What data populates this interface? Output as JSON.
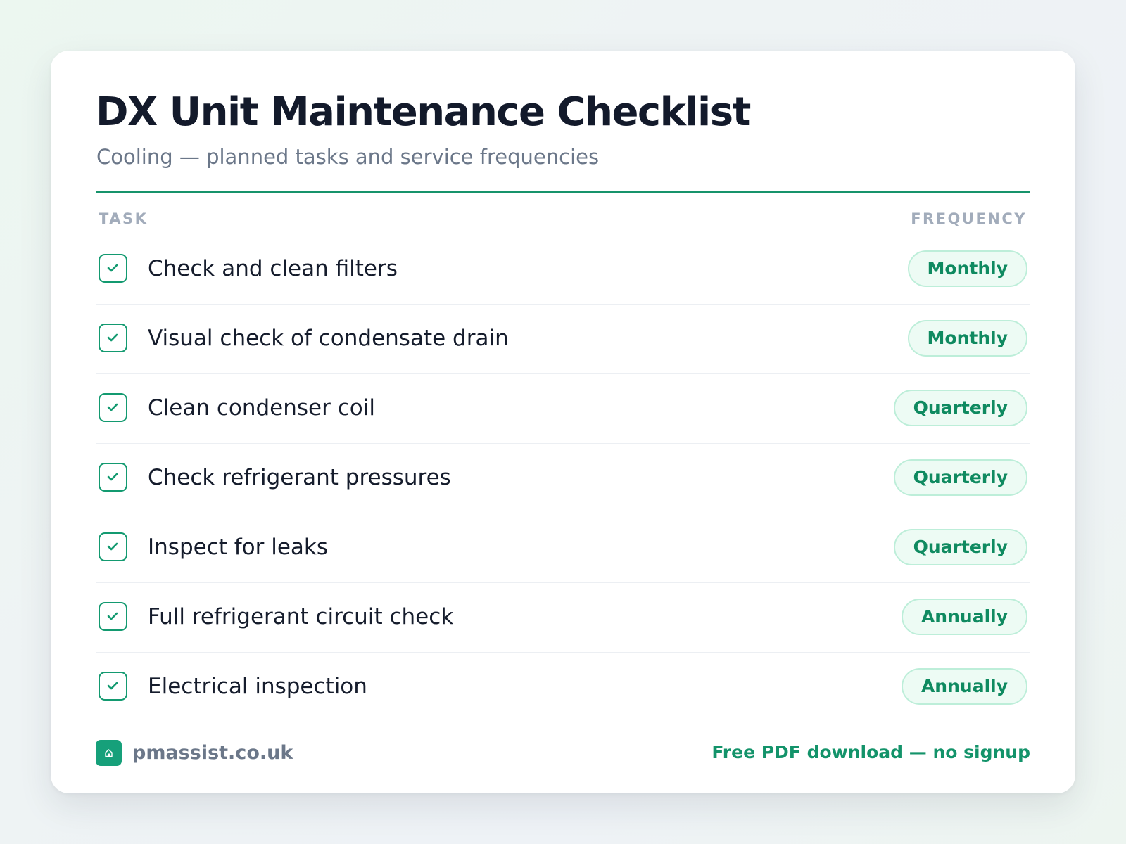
{
  "header": {
    "title": "DX Unit Maintenance Checklist",
    "subtitle": "Cooling — planned tasks and service frequencies"
  },
  "table": {
    "columns": {
      "task": "TASK",
      "frequency": "FREQUENCY"
    },
    "rows": [
      {
        "task": "Check and clean filters",
        "frequency": "Monthly",
        "checked": true
      },
      {
        "task": "Visual check of condensate drain",
        "frequency": "Monthly",
        "checked": true
      },
      {
        "task": "Clean condenser coil",
        "frequency": "Quarterly",
        "checked": true
      },
      {
        "task": "Check refrigerant pressures",
        "frequency": "Quarterly",
        "checked": true
      },
      {
        "task": "Inspect for leaks",
        "frequency": "Quarterly",
        "checked": true
      },
      {
        "task": "Full refrigerant circuit check",
        "frequency": "Annually",
        "checked": true
      },
      {
        "task": "Electrical inspection",
        "frequency": "Annually",
        "checked": true
      }
    ]
  },
  "footer": {
    "site": "pmassist.co.uk",
    "cta": "Free PDF download — no signup"
  },
  "icons": {
    "check": "check-icon",
    "logo": "house-icon"
  },
  "colors": {
    "accent": "#16936b",
    "pill_text": "#0f8a60",
    "pill_bg": "#edfbf4",
    "pill_border": "#bdeed9",
    "title": "#131a2b",
    "muted": "#6b7789"
  }
}
